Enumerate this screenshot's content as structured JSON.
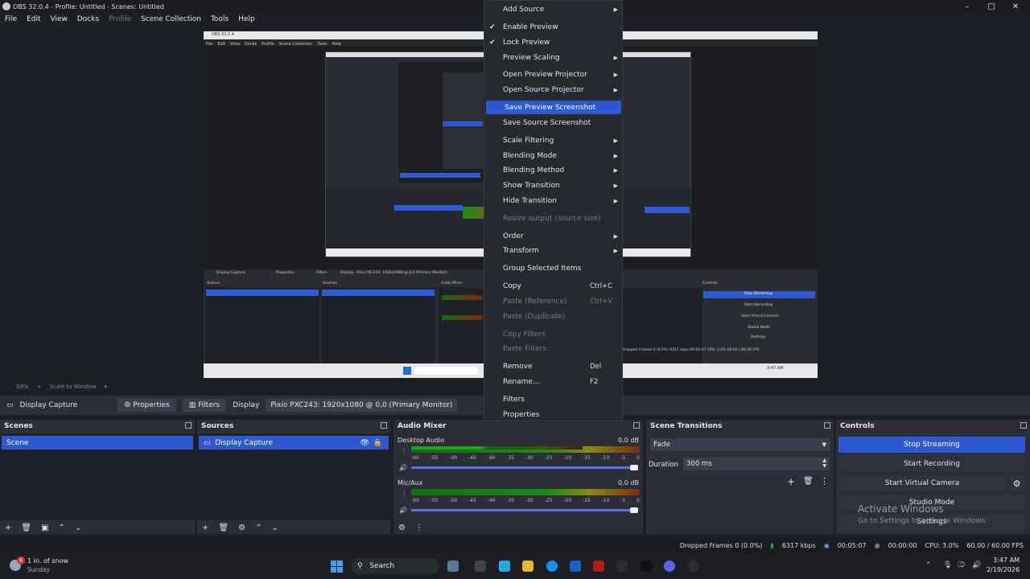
{
  "window": {
    "title": "OBS 32.0.4 - Profile: Untitled - Scenes: Untitled"
  },
  "menubar": [
    "File",
    "Edit",
    "View",
    "Docks",
    "Profile",
    "Scene Collection",
    "Tools",
    "Help"
  ],
  "preview": {
    "zoom": "59%",
    "scale_mode": "Scale to Window"
  },
  "source_bar": {
    "source_name": "Display Capture",
    "properties_label": "Properties",
    "filters_label": "Filters",
    "display_label": "Display",
    "display_value": "Pixio PXC243: 1920x1080 @ 0,0 (Primary Monitor)"
  },
  "scenes": {
    "title": "Scenes",
    "items": [
      "Scene"
    ]
  },
  "sources": {
    "title": "Sources",
    "items": [
      "Display Capture"
    ]
  },
  "audio_mixer": {
    "title": "Audio Mixer",
    "channels": [
      {
        "name": "Desktop Audio",
        "db": "0.0 dB",
        "level": 0.75
      },
      {
        "name": "Mic/Aux",
        "db": "0.0 dB",
        "level": 1.0
      }
    ],
    "ticks": [
      "-60",
      "-55",
      "-50",
      "-45",
      "-40",
      "-35",
      "-30",
      "-25",
      "-20",
      "-15",
      "-10",
      "-5",
      "0"
    ]
  },
  "scene_transitions": {
    "title": "Scene Transitions",
    "transition": "Fade",
    "duration_label": "Duration",
    "duration_value": "300 ms"
  },
  "controls": {
    "title": "Controls",
    "stop_streaming": "Stop Streaming",
    "start_recording": "Start Recording",
    "start_virtual_camera": "Start Virtual Camera",
    "studio_mode": "Studio Mode",
    "settings": "Settings"
  },
  "watermark": {
    "line1": "Activate Windows",
    "line2": "Go to Settings to activate Windows."
  },
  "status_bar": {
    "dropped_frames": "Dropped Frames 0 (0.0%)",
    "bitrate": "6317 kbps",
    "stream_time": "00:05:07",
    "rec_time": "00:00:00",
    "cpu": "CPU: 3.0%",
    "fps": "60.00 / 60.00 FPS"
  },
  "taskbar": {
    "weather_temp": "1 in. of snow",
    "weather_day": "Sunday",
    "badge": "6",
    "search": "Search",
    "time": "3:47 AM",
    "date": "2/19/2026"
  },
  "context_menu": {
    "items": [
      {
        "label": "Add Source",
        "submenu": true
      },
      {
        "label": "Enable Preview",
        "checked": true
      },
      {
        "label": "Lock Preview",
        "checked": true
      },
      {
        "label": "Preview Scaling",
        "submenu": true
      },
      {
        "label": "Open Preview Projector",
        "submenu": true
      },
      {
        "label": "Open Source Projector",
        "submenu": true
      },
      {
        "label": "Save Preview Screenshot",
        "highlighted": true
      },
      {
        "label": "Save Source Screenshot"
      },
      {
        "label": "Scale Filtering",
        "submenu": true
      },
      {
        "label": "Blending Mode",
        "submenu": true
      },
      {
        "label": "Blending Method",
        "submenu": true
      },
      {
        "label": "Show Transition",
        "submenu": true
      },
      {
        "label": "Hide Transition",
        "submenu": true
      },
      {
        "label": "Resize output (source size)",
        "disabled": true
      },
      {
        "label": "Order",
        "submenu": true
      },
      {
        "label": "Transform",
        "submenu": true
      },
      {
        "label": "Group Selected Items"
      },
      {
        "label": "Copy",
        "shortcut": "Ctrl+C"
      },
      {
        "label": "Paste (Reference)",
        "shortcut": "Ctrl+V",
        "disabled": true
      },
      {
        "label": "Paste (Duplicate)",
        "disabled": true
      },
      {
        "label": "Copy Filters",
        "disabled": true
      },
      {
        "label": "Paste Filters",
        "disabled": true
      },
      {
        "label": "Remove",
        "shortcut": "Del"
      },
      {
        "label": "Rename...",
        "shortcut": "F2"
      },
      {
        "label": "Filters"
      },
      {
        "label": "Properties"
      }
    ]
  }
}
